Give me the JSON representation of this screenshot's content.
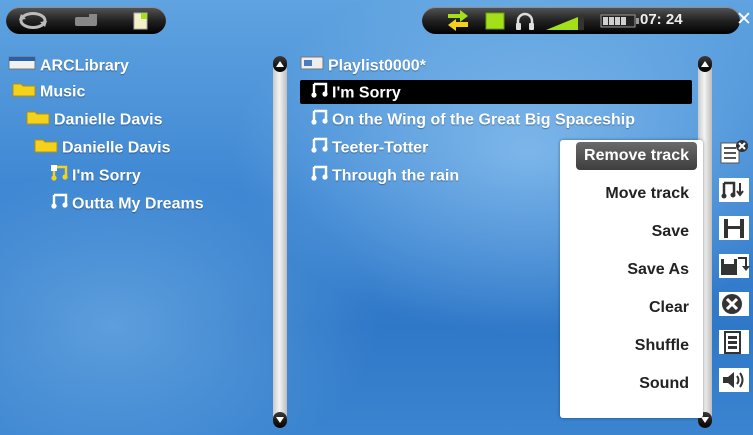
{
  "status": {
    "time": "07: 24"
  },
  "library": {
    "root": "ARCLibrary",
    "items": [
      {
        "label": "Music"
      },
      {
        "label": "Danielle Davis"
      },
      {
        "label": "Danielle Davis"
      },
      {
        "label": "I'm Sorry"
      },
      {
        "label": "Outta My Dreams"
      }
    ]
  },
  "playlist": {
    "title": "Playlist0000*",
    "tracks": [
      {
        "label": "I'm Sorry"
      },
      {
        "label": "On the Wing of the Great Big Spaceship"
      },
      {
        "label": "Teeter-Totter"
      },
      {
        "label": "Through the rain"
      }
    ]
  },
  "menu": {
    "items": [
      {
        "label": "Remove track"
      },
      {
        "label": "Move track"
      },
      {
        "label": "Save"
      },
      {
        "label": "Save As"
      },
      {
        "label": "Clear"
      },
      {
        "label": "Shuffle"
      },
      {
        "label": "Sound"
      }
    ]
  },
  "icons": {
    "menu": [
      "remove-track-icon",
      "move-track-icon",
      "save-icon",
      "save-as-icon",
      "clear-icon",
      "shuffle-icon",
      "sound-icon"
    ],
    "status": [
      "transfer-icon",
      "folder-icon",
      "headphones-icon",
      "volume-icon",
      "battery-icon"
    ]
  },
  "colors": {
    "background": "#3d86d2",
    "folder": "#f4d21c",
    "status_green": "#a3e01a"
  }
}
